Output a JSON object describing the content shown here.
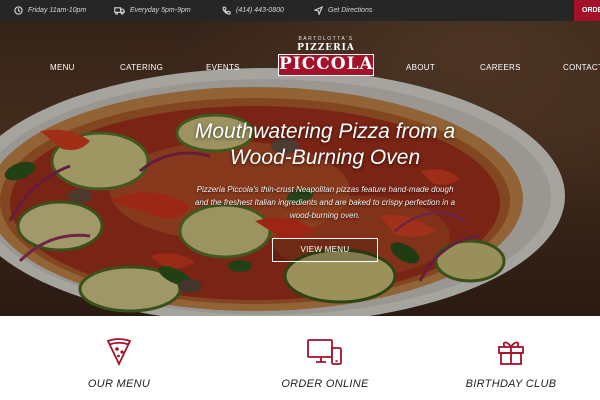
{
  "topbar": {
    "hours_dinein": "Friday 11am-10pm",
    "hours_delivery": "Everyday 5pm-9pm",
    "phone": "(414) 443-0800",
    "directions": "Get Directions",
    "order_label": "ORDER"
  },
  "nav": {
    "menu": "MENU",
    "catering": "CATERING",
    "events": "EVENTS",
    "about": "ABOUT",
    "careers": "CAREERS",
    "contact": "CONTACT"
  },
  "logo": {
    "tagline": "BARTOLOTTA'S",
    "line1": "PIZZERIA",
    "line2": "PICCOLA"
  },
  "hero": {
    "headline_line1": "Mouthwatering Pizza from a",
    "headline_line2": "Wood-Burning Oven",
    "subtext": "Pizzeria Piccola's thin-crust Neapolitan pizzas feature hand-made dough and the freshest Italian ingredients and are baked to crispy perfection in a wood-burning oven.",
    "button": "VIEW MENU"
  },
  "features": [
    {
      "label": "OUR MENU",
      "icon": "pizza-slice-icon"
    },
    {
      "label": "ORDER ONLINE",
      "icon": "devices-icon"
    },
    {
      "label": "BIRTHDAY CLUB",
      "icon": "gift-icon"
    }
  ],
  "colors": {
    "accent": "#a3112b",
    "topbar_bg": "#262626"
  }
}
